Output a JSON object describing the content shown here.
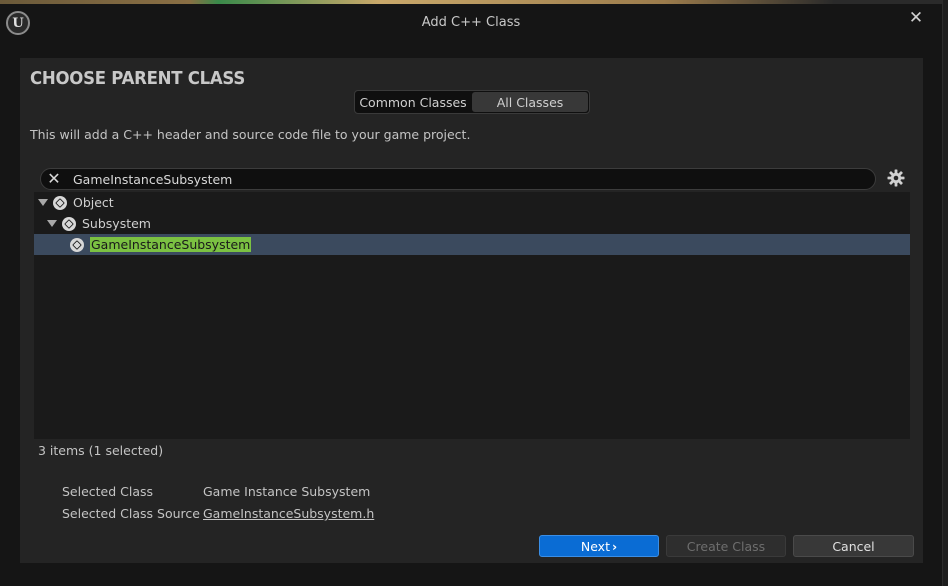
{
  "window": {
    "title": "Add C++ Class",
    "logo_text": "U",
    "close_glyph": "✕"
  },
  "panel": {
    "heading": "CHOOSE PARENT CLASS",
    "tabs": [
      {
        "label": "Common Classes",
        "active": false
      },
      {
        "label": "All Classes",
        "active": true
      }
    ],
    "description": "This will add a C++ header and source code file to your game project."
  },
  "search": {
    "value": "GameInstanceSubsystem",
    "clear_glyph": "✕"
  },
  "tree": {
    "items": [
      {
        "label": "Object",
        "depth": 0,
        "expanded": true,
        "selected": false
      },
      {
        "label": "Subsystem",
        "depth": 1,
        "expanded": true,
        "selected": false
      },
      {
        "label": "GameInstanceSubsystem",
        "depth": 2,
        "expanded": false,
        "selected": true
      }
    ]
  },
  "status": {
    "count": "3 items (1 selected)"
  },
  "details": {
    "selected_class_label": "Selected Class",
    "selected_class_value": "Game Instance Subsystem",
    "selected_source_label": "Selected Class Source",
    "selected_source_value": "GameInstanceSubsystem.h"
  },
  "buttons": {
    "next": "Next",
    "next_chevron": "›",
    "create": "Create Class",
    "cancel": "Cancel"
  },
  "colors": {
    "accent": "#0a6cd4",
    "selection": "#3b4a5e",
    "highlight": "#7bc142"
  },
  "icons": [
    "unreal-logo-icon",
    "close-icon",
    "clear-search-icon",
    "settings-gear-icon",
    "class-icon",
    "expand-arrow-icon",
    "chevron-right-icon"
  ]
}
